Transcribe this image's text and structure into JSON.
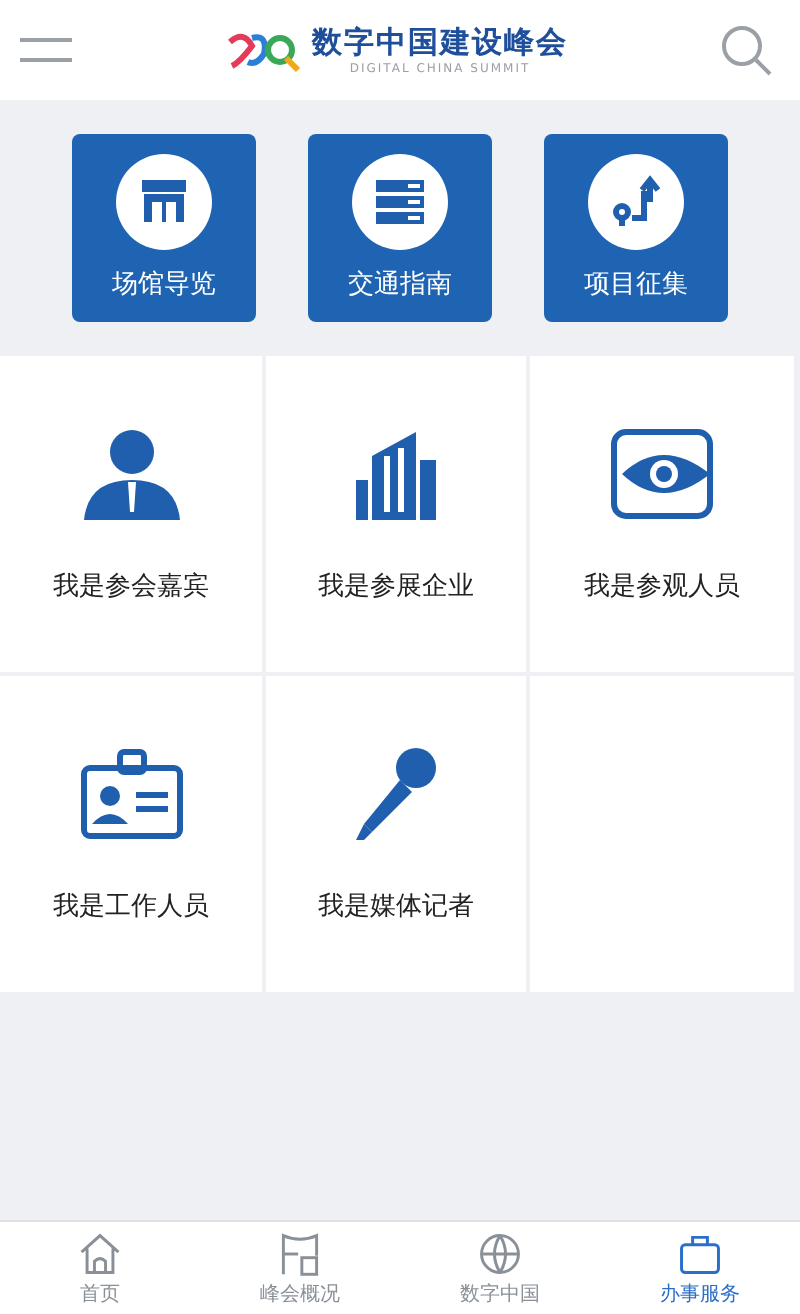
{
  "header": {
    "title": "数字中国建设峰会",
    "subtitle": "DIGITAL CHINA SUMMIT"
  },
  "quick_links": [
    {
      "label": "场馆导览"
    },
    {
      "label": "交通指南"
    },
    {
      "label": "项目征集"
    }
  ],
  "roles": [
    {
      "label": "我是参会嘉宾"
    },
    {
      "label": "我是参展企业"
    },
    {
      "label": "我是参观人员"
    },
    {
      "label": "我是工作人员"
    },
    {
      "label": "我是媒体记者"
    }
  ],
  "tabs": [
    {
      "label": "首页",
      "selected": false
    },
    {
      "label": "峰会概况",
      "selected": false
    },
    {
      "label": "数字中国",
      "selected": false
    },
    {
      "label": "办事服务",
      "selected": true
    }
  ]
}
